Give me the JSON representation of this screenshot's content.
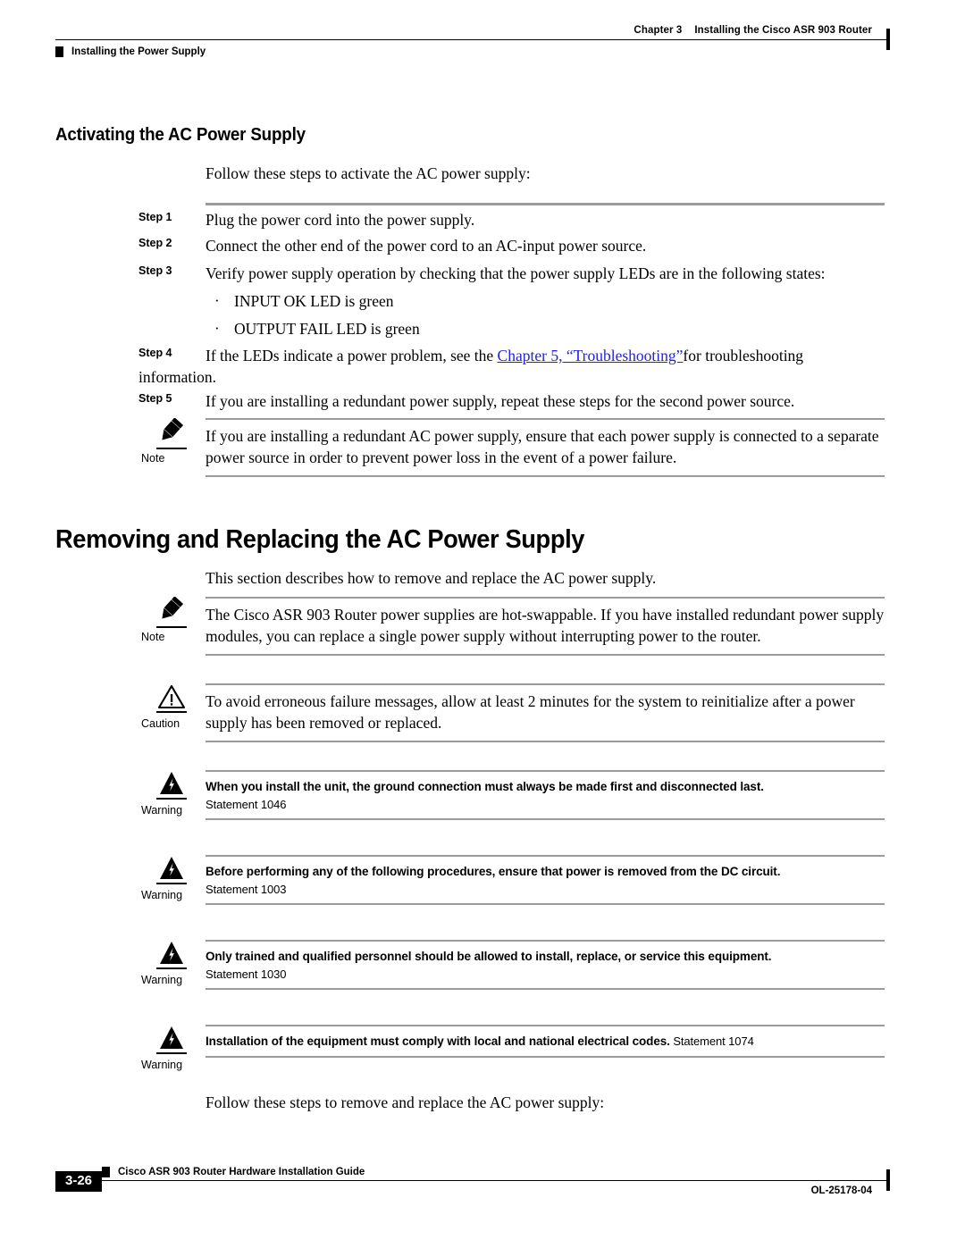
{
  "header": {
    "chapter": "Chapter 3",
    "chapter_title": "Installing the Cisco ASR 903 Router",
    "section": "Installing the Power Supply"
  },
  "section1": {
    "heading": "Activating the AC Power Supply",
    "intro": "Follow these steps to activate the AC power supply:",
    "steps": [
      {
        "label": "Step 1",
        "text": "Plug the power cord into the power supply."
      },
      {
        "label": "Step 2",
        "text": "Connect the other end of the power cord to an AC-input power source."
      },
      {
        "label": "Step 3",
        "text": "Verify power supply operation by checking that the power supply LEDs are in the following states:"
      },
      {
        "label": "Step 4",
        "text_before": "If the LEDs indicate a power problem, see the ",
        "link": "Chapter 5, “Troubleshooting”",
        "text_after": "for troubleshooting information."
      },
      {
        "label": "Step 5",
        "text": "If you are installing a redundant power supply, repeat these steps for the second power source."
      }
    ],
    "bullets": [
      {
        "dot": "·",
        "text": "INPUT OK LED is green"
      },
      {
        "dot": "·",
        "text": "OUTPUT FAIL LED is green"
      }
    ],
    "note": {
      "label": "Note",
      "icon": "pencil-icon",
      "text": "If you are installing a redundant AC power supply, ensure that each power supply is connected to a separate power source in order to prevent power loss in the event of a power failure."
    }
  },
  "section2": {
    "heading": "Removing and Replacing the AC Power Supply",
    "intro": "This section describes how to remove and replace the AC power supply.",
    "note": {
      "label": "Note",
      "icon": "pencil-icon",
      "text": "The Cisco ASR 903 Router power supplies are hot-swappable. If you have installed redundant power supply modules, you can replace a single power supply without interrupting power to the router."
    },
    "caution": {
      "label": "Caution",
      "icon": "warning-triangle-outline-icon",
      "text": "To avoid erroneous failure messages, allow at least 2 minutes for the system to reinitialize after a power supply has been removed or replaced."
    },
    "warnings": [
      {
        "label": "Warning",
        "icon": "warning-lightning-triangle-icon",
        "text": "When you install the unit, the ground connection must always be made first and disconnected last.",
        "statement": "Statement 1046",
        "statement_inline": false
      },
      {
        "label": "Warning",
        "icon": "warning-lightning-triangle-icon",
        "text": "Before performing any of the following procedures, ensure that power is removed from the DC circuit.",
        "statement": "Statement 1003",
        "statement_inline": false
      },
      {
        "label": "Warning",
        "icon": "warning-lightning-triangle-icon",
        "text": "Only trained and qualified personnel should be allowed to install, replace, or service this equipment.",
        "statement": "Statement 1030",
        "statement_inline": false
      },
      {
        "label": "Warning",
        "icon": "warning-lightning-triangle-icon",
        "text": "Installation of the equipment must comply with local and national electrical codes.",
        "statement": "Statement 1074",
        "statement_inline": true
      }
    ],
    "outro": "Follow these steps to remove and replace the AC power supply:"
  },
  "footer": {
    "guide_title": "Cisco ASR 903 Router Hardware Installation Guide",
    "page_number": "3-26",
    "doc_id": "OL-25178-04"
  },
  "colors": {
    "link": "#2222dd",
    "rule_gray": "#9a9a9a",
    "text": "#000000"
  }
}
